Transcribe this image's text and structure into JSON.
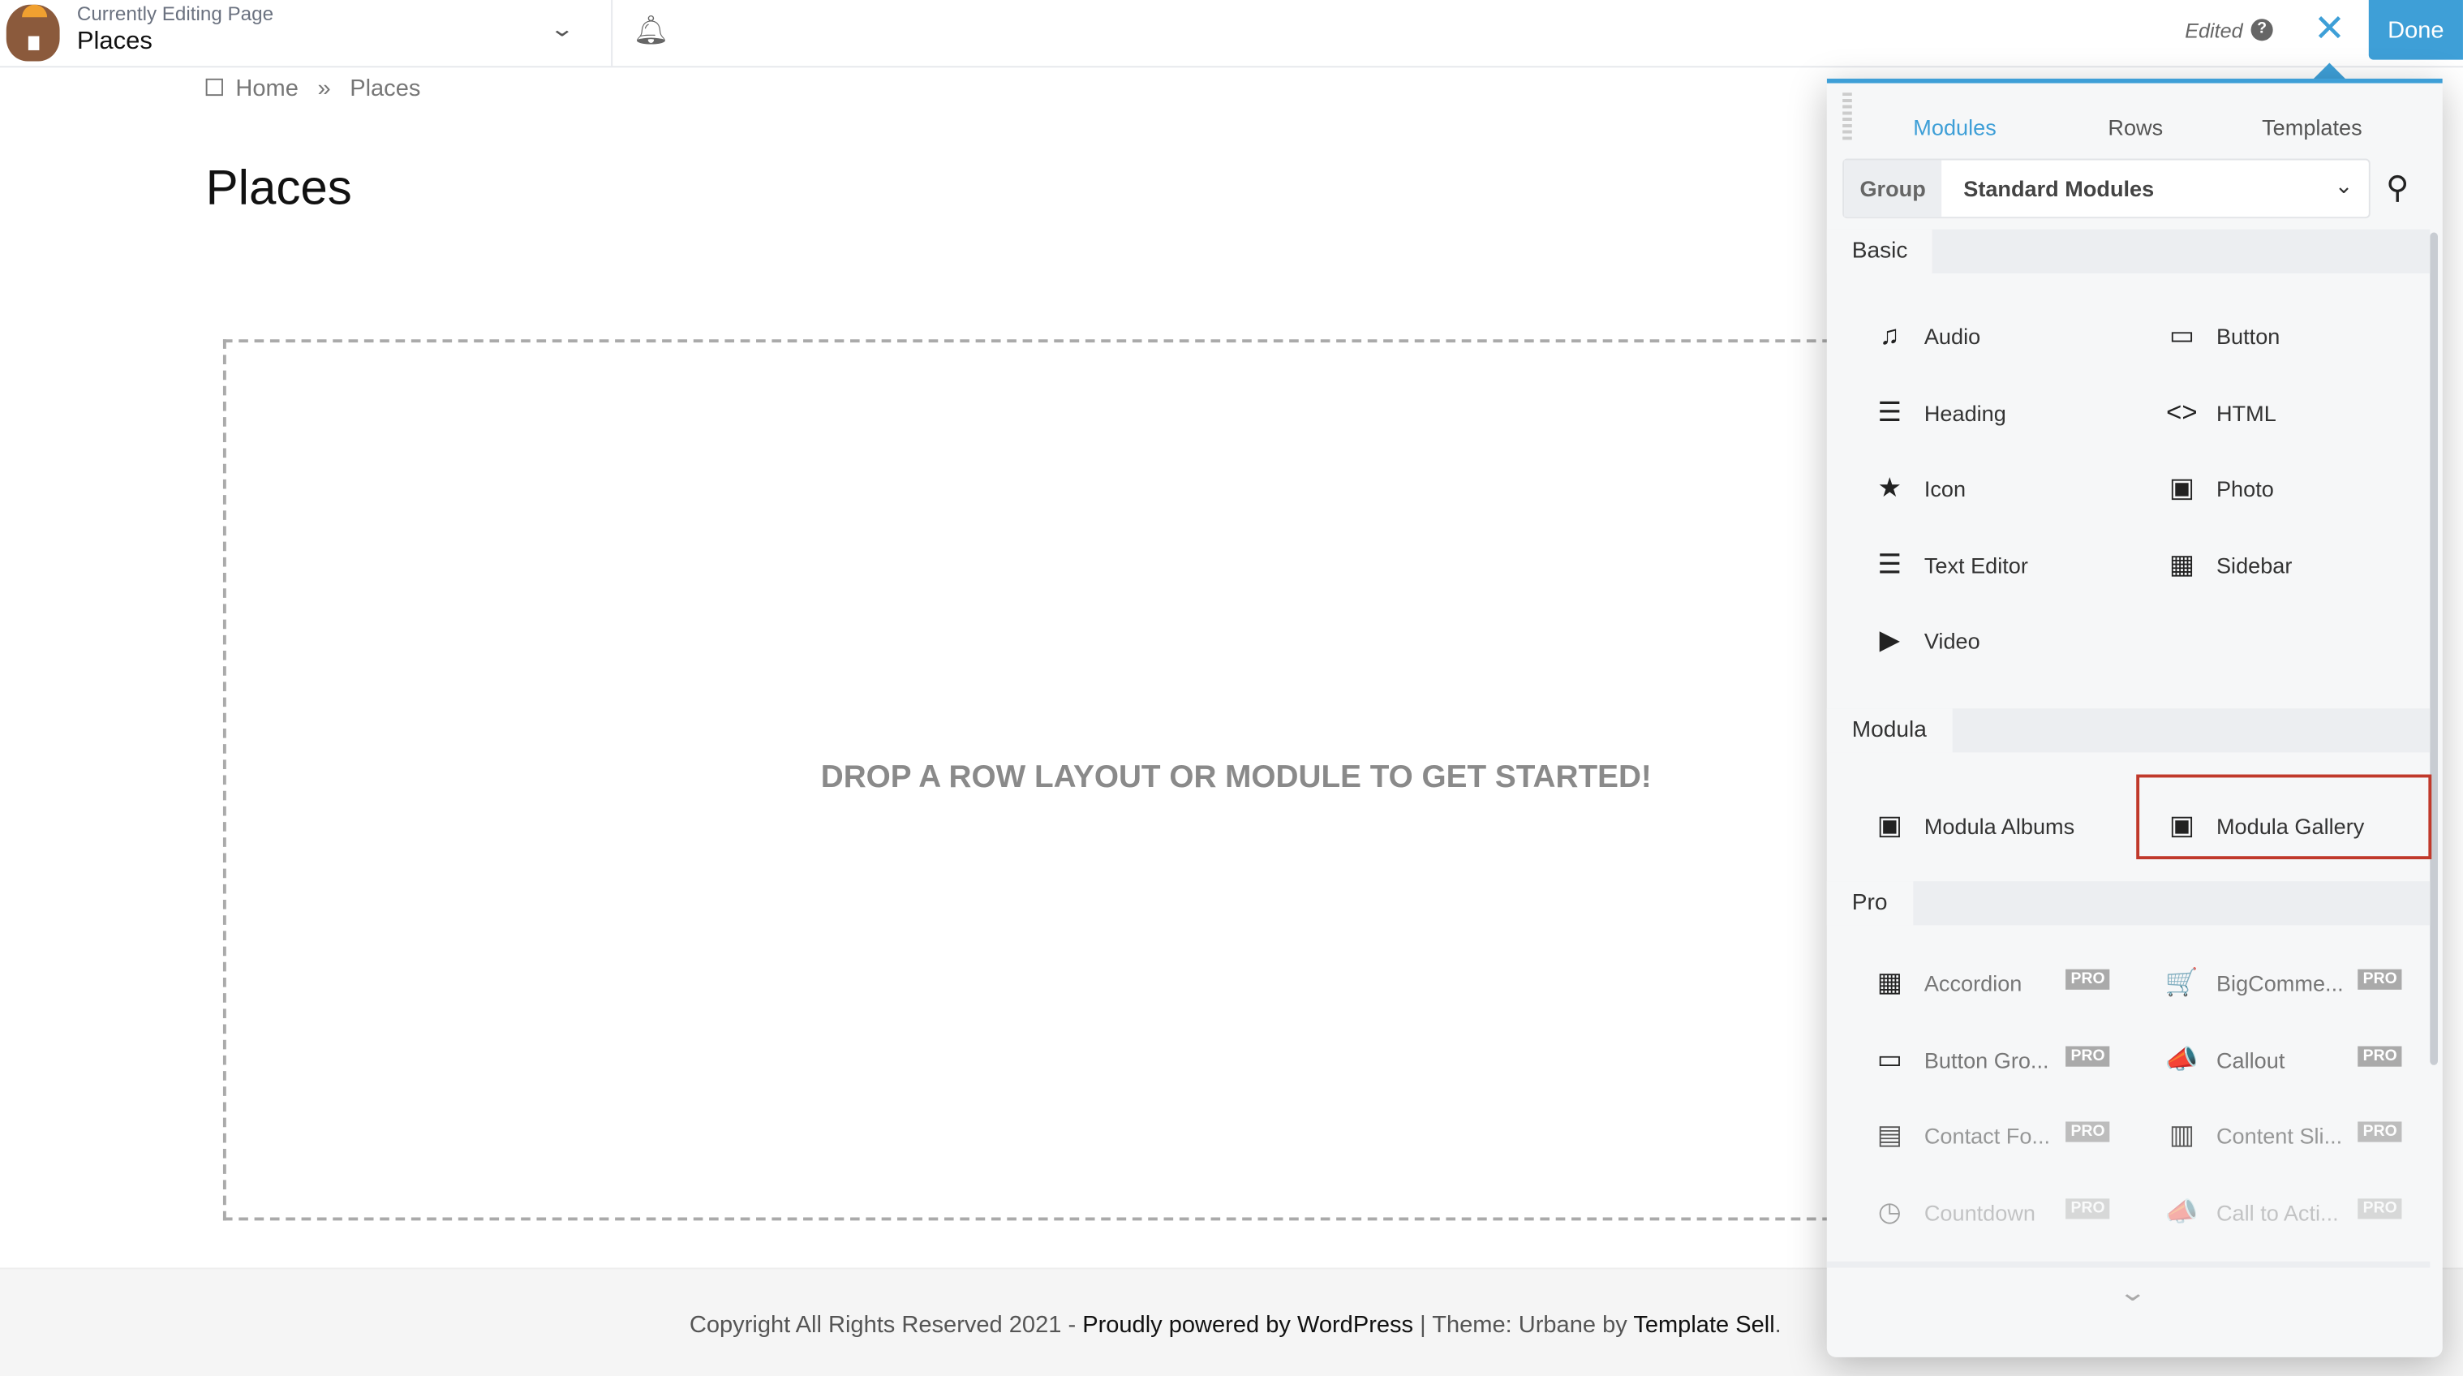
{
  "topbar": {
    "subtitle": "Currently Editing Page",
    "title": "Places",
    "status": "Edited",
    "done_label": "Done"
  },
  "breadcrumb": {
    "home": "Home",
    "sep": "»",
    "current": "Places"
  },
  "page": {
    "title": "Places",
    "drop_text": "DROP A ROW LAYOUT OR MODULE TO GET STARTED!"
  },
  "footer": {
    "text1": "Copyright All Rights Reserved 2021 - ",
    "link1": "Proudly powered by WordPress",
    "text2": " | Theme: Urbane by ",
    "link2": "Template Sell",
    "text3": "."
  },
  "panel": {
    "tabs": [
      "Modules",
      "Rows",
      "Templates"
    ],
    "group_label": "Group",
    "group_value": "Standard Modules",
    "sections": [
      {
        "title": "Basic",
        "items": [
          {
            "label": "Audio",
            "icon": "♫"
          },
          {
            "label": "Button",
            "icon": "▭"
          },
          {
            "label": "Heading",
            "icon": "☰"
          },
          {
            "label": "HTML",
            "icon": "<>"
          },
          {
            "label": "Icon",
            "icon": "★"
          },
          {
            "label": "Photo",
            "icon": "▣"
          },
          {
            "label": "Text Editor",
            "icon": "☰"
          },
          {
            "label": "Sidebar",
            "icon": "▦"
          },
          {
            "label": "Video",
            "icon": "▶"
          }
        ]
      },
      {
        "title": "Modula",
        "items": [
          {
            "label": "Modula Albums",
            "icon": "▣"
          },
          {
            "label": "Modula Gallery",
            "icon": "▣"
          }
        ]
      },
      {
        "title": "Pro",
        "items": [
          {
            "label": "Accordion",
            "icon": "▦"
          },
          {
            "label": "BigComme...",
            "icon": "🛒"
          },
          {
            "label": "Button Gro...",
            "icon": "▭"
          },
          {
            "label": "Callout",
            "icon": "📣"
          },
          {
            "label": "Contact Fo...",
            "icon": "▤"
          },
          {
            "label": "Content Sli...",
            "icon": "▥"
          },
          {
            "label": "Countdown",
            "icon": "◷"
          },
          {
            "label": "Call to Acti...",
            "icon": "📣"
          }
        ],
        "badge": "PRO"
      }
    ],
    "accent": "#3e9fd7",
    "highlight": "#c0392b"
  }
}
